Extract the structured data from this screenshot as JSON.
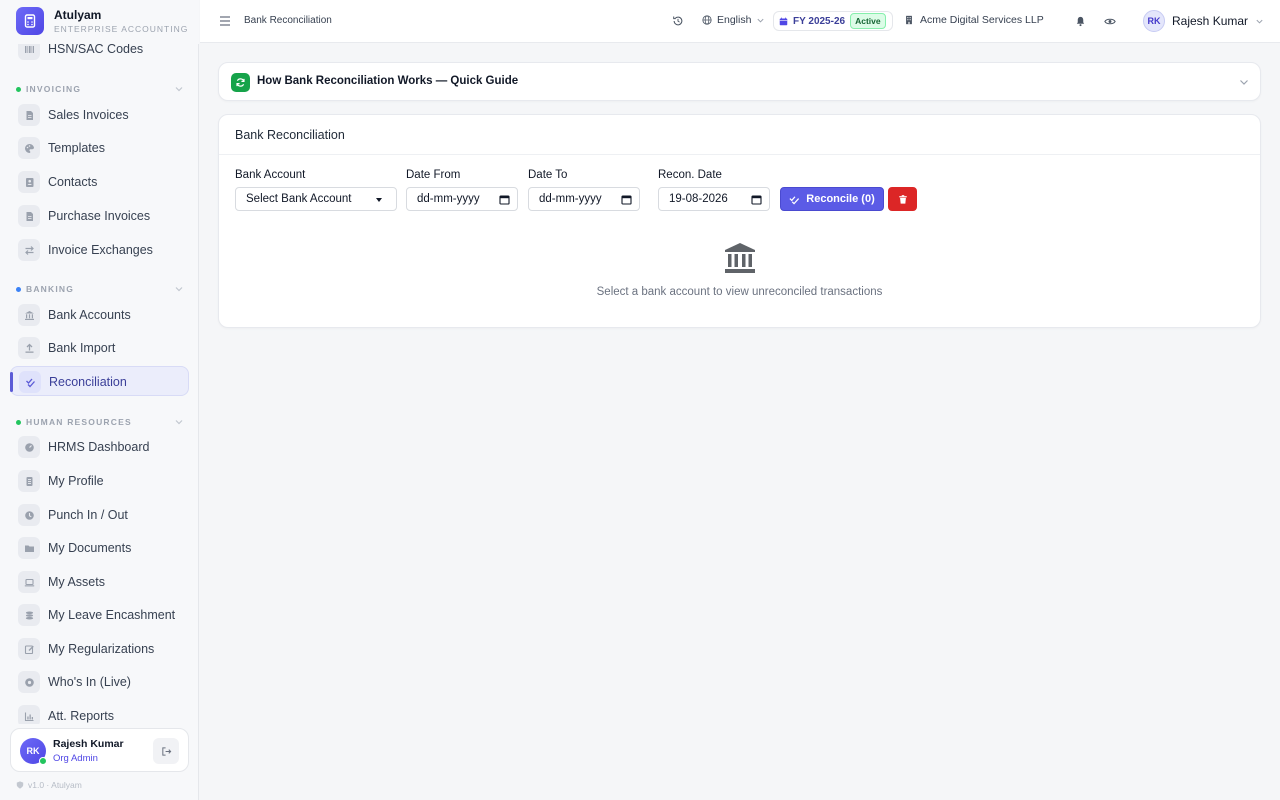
{
  "brand": {
    "name": "Atulyam",
    "subtitle": "ENTERPRISE ACCOUNTING"
  },
  "sidebar": {
    "top_item": {
      "label": "HSN/SAC Codes",
      "icon": "barcode-icon"
    },
    "sections": [
      {
        "title": "INVOICING",
        "dot_color": "#22c55e",
        "items": [
          {
            "label": "Sales Invoices",
            "icon": "file-icon"
          },
          {
            "label": "Templates",
            "icon": "palette-icon"
          },
          {
            "label": "Contacts",
            "icon": "contact-icon"
          },
          {
            "label": "Purchase Invoices",
            "icon": "file-icon"
          },
          {
            "label": "Invoice Exchanges",
            "icon": "exchange-icon"
          }
        ]
      },
      {
        "title": "BANKING",
        "dot_color": "#3b82f6",
        "items": [
          {
            "label": "Bank Accounts",
            "icon": "bank-icon"
          },
          {
            "label": "Bank Import",
            "icon": "upload-icon"
          },
          {
            "label": "Reconciliation",
            "icon": "double-check-icon",
            "active": true
          }
        ]
      },
      {
        "title": "HUMAN RESOURCES",
        "dot_color": "#22c55e",
        "items": [
          {
            "label": "HRMS Dashboard",
            "icon": "gauge-icon"
          },
          {
            "label": "My Profile",
            "icon": "id-card-icon"
          },
          {
            "label": "Punch In / Out",
            "icon": "clock-icon"
          },
          {
            "label": "My Documents",
            "icon": "folder-icon"
          },
          {
            "label": "My Assets",
            "icon": "laptop-icon"
          },
          {
            "label": "My Leave Encashment",
            "icon": "coins-icon"
          },
          {
            "label": "My Regularizations",
            "icon": "edit-icon"
          },
          {
            "label": "Who's In (Live)",
            "icon": "live-dot-icon"
          },
          {
            "label": "Att. Reports",
            "icon": "chart-icon"
          }
        ]
      }
    ],
    "user": {
      "initials": "RK",
      "name": "Rajesh Kumar",
      "role": "Org Admin"
    },
    "version": "v1.0 · Atulyam"
  },
  "topbar": {
    "breadcrumb": "Bank Reconciliation",
    "language": "English",
    "fiscal_year": "FY 2025-26",
    "fy_status": "Active",
    "organization": "Acme Digital Services LLP",
    "user": {
      "initials": "RK",
      "name": "Rajesh Kumar"
    }
  },
  "guide": {
    "title": "How Bank Reconciliation Works — Quick Guide"
  },
  "card": {
    "title": "Bank Reconciliation",
    "fields": {
      "bank_account": {
        "label": "Bank Account",
        "value": "Select Bank Account"
      },
      "date_from": {
        "label": "Date From",
        "value": "dd-mm-yyyy"
      },
      "date_to": {
        "label": "Date To",
        "value": "dd-mm-yyyy"
      },
      "recon_date": {
        "label": "Recon. Date",
        "value": "19-08-2026"
      }
    },
    "reconcile_label": "Reconcile (0)",
    "empty_message": "Select a bank account to view unreconciled transactions"
  },
  "colors": {
    "accent": "#5b5be6",
    "danger": "#dc2626",
    "success": "#16a34a"
  }
}
